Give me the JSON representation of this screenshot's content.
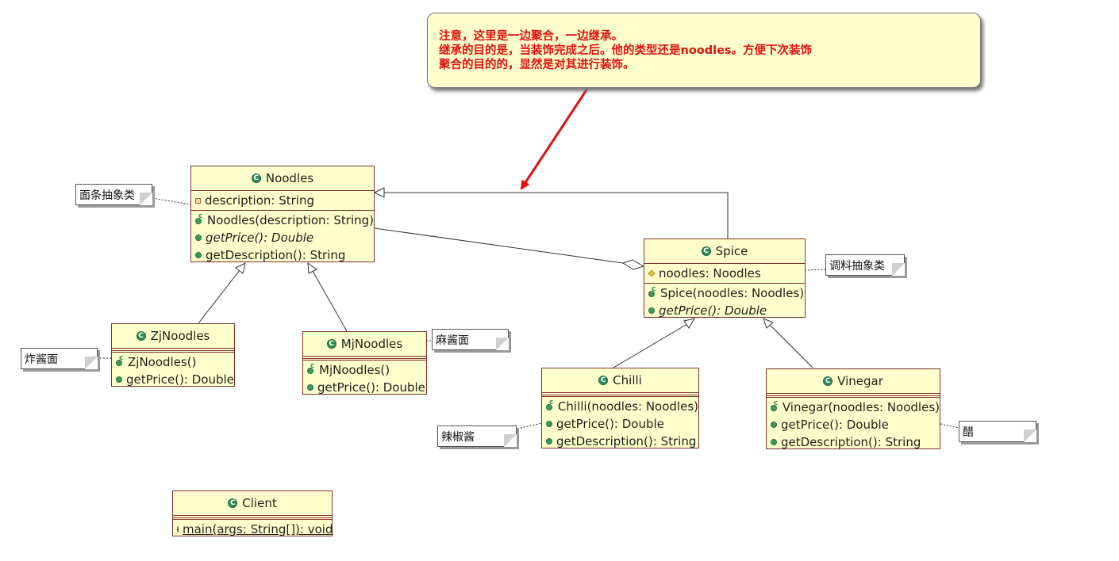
{
  "callout": {
    "lines": [
      "注意，这里是一边聚合，一边继承。",
      "继承的目的是，当装饰完成之后。他的类型还是noodles。方便下次装饰",
      "聚合的目的的，显然是对其进行装饰。"
    ],
    "color": "#e01010"
  },
  "classes": {
    "noodles": {
      "name": "Noodles",
      "fields": [
        {
          "text": "description: String",
          "visibility": "private"
        }
      ],
      "methods": [
        {
          "text": "Noodles(description: String)",
          "kind": "constructor"
        },
        {
          "text": "getPrice(): Double",
          "kind": "abstract"
        },
        {
          "text": "getDescription(): String",
          "kind": "public"
        }
      ]
    },
    "spice": {
      "name": "Spice",
      "fields": [
        {
          "text": "noodles: Noodles",
          "visibility": "protected"
        }
      ],
      "methods": [
        {
          "text": "Spice(noodles: Noodles)",
          "kind": "constructor"
        },
        {
          "text": "getPrice(): Double",
          "kind": "abstract"
        }
      ]
    },
    "zjnoodles": {
      "name": "ZjNoodles",
      "methods": [
        {
          "text": "ZjNoodles()",
          "kind": "constructor"
        },
        {
          "text": "getPrice(): Double",
          "kind": "public"
        }
      ]
    },
    "mjnoodles": {
      "name": "MjNoodles",
      "methods": [
        {
          "text": "MjNoodles()",
          "kind": "constructor"
        },
        {
          "text": "getPrice(): Double",
          "kind": "public"
        }
      ]
    },
    "chilli": {
      "name": "Chilli",
      "methods": [
        {
          "text": "Chilli(noodles: Noodles)",
          "kind": "constructor"
        },
        {
          "text": "getPrice(): Double",
          "kind": "public"
        },
        {
          "text": "getDescription(): String",
          "kind": "public"
        }
      ]
    },
    "vinegar": {
      "name": "Vinegar",
      "methods": [
        {
          "text": "Vinegar(noodles: Noodles)",
          "kind": "constructor"
        },
        {
          "text": "getPrice(): Double",
          "kind": "public"
        },
        {
          "text": "getDescription(): String",
          "kind": "public"
        }
      ]
    },
    "client": {
      "name": "Client",
      "methods": [
        {
          "text": "main(args: String[]): void",
          "kind": "static"
        }
      ]
    }
  },
  "notes": {
    "noodles": "面条抽象类",
    "spice": "调料抽象类",
    "zjnoodles": "炸酱面",
    "mjnoodles": "麻酱面",
    "chilli": "辣椒酱",
    "vinegar": "醋"
  },
  "class_icon_letter": "C",
  "colors": {
    "class_fill": "#ffffcc",
    "class_border": "#7f2f2f",
    "arrow": "#e01010"
  }
}
